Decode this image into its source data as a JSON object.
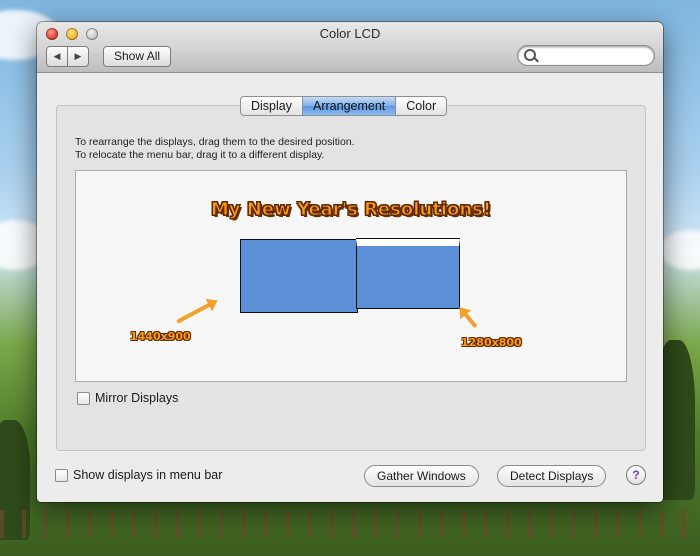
{
  "window": {
    "title": "Color LCD"
  },
  "toolbar": {
    "back_icon": "back-arrow-icon",
    "forward_icon": "forward-arrow-icon",
    "show_all_label": "Show All",
    "search_icon": "magnifier-icon",
    "search_value": ""
  },
  "tabs": [
    {
      "label": "Display",
      "active": false
    },
    {
      "label": "Arrangement",
      "active": true
    },
    {
      "label": "Color",
      "active": false
    }
  ],
  "arrangement": {
    "instruction_1": "To rearrange the displays, drag them to the desired position.",
    "instruction_2": "To relocate the menu bar, drag it to a different display.",
    "headline": "My New Year's Resolutions!",
    "display_1_resolution": "1440x900",
    "display_2_resolution": "1280x800",
    "display_color": "#5b8fd6",
    "annotation_color": "#f2a12c"
  },
  "options": {
    "mirror_label": "Mirror Displays",
    "mirror_checked": false,
    "show_menu_label": "Show displays in menu bar",
    "show_menu_checked": false
  },
  "buttons": {
    "gather": "Gather Windows",
    "detect": "Detect Displays",
    "help": "?"
  }
}
